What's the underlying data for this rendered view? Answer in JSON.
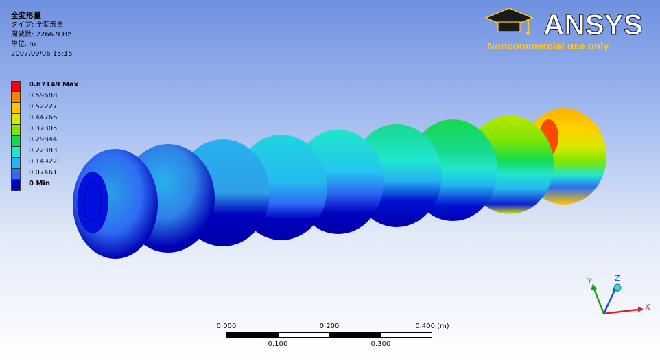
{
  "info": {
    "title": "全変形量",
    "type_line": "タイプ: 全変形量",
    "freq_line": "周波数: 2266.9 Hz",
    "unit_line": "単位: m",
    "date_line": "2007/09/06 15:15"
  },
  "legend": [
    {
      "label": "0.67149 Max",
      "color": "#ff0000",
      "bold": true
    },
    {
      "label": "0.59688",
      "color": "#ff7f00",
      "bold": false
    },
    {
      "label": "0.52227",
      "color": "#ffc400",
      "bold": false
    },
    {
      "label": "0.44766",
      "color": "#d9e600",
      "bold": false
    },
    {
      "label": "0.37305",
      "color": "#7fe600",
      "bold": false
    },
    {
      "label": "0.29844",
      "color": "#18d94c",
      "bold": false
    },
    {
      "label": "0.22383",
      "color": "#1fe6d0",
      "bold": false
    },
    {
      "label": "0.14922",
      "color": "#25b2f0",
      "bold": false
    },
    {
      "label": "0.07461",
      "color": "#2e6cf2",
      "bold": false
    },
    {
      "label": "0 Min",
      "color": "#0000c8",
      "bold": true
    }
  ],
  "logo": {
    "brand": "ANSYS",
    "note": "Noncommercial use only"
  },
  "scale_bar": {
    "top_labels": [
      "0.000",
      "0.200",
      "0.400 (m)"
    ],
    "bottom_labels": [
      "0.100",
      "0.300"
    ]
  },
  "triad": {
    "x": "X",
    "y": "Y",
    "z": "Z"
  },
  "colors": {
    "accent_gold": "#ffc62e",
    "brand_white": "#ffffff",
    "axis_x": "#e02020",
    "axis_y": "#20a020",
    "axis_z": "#2040e0"
  }
}
